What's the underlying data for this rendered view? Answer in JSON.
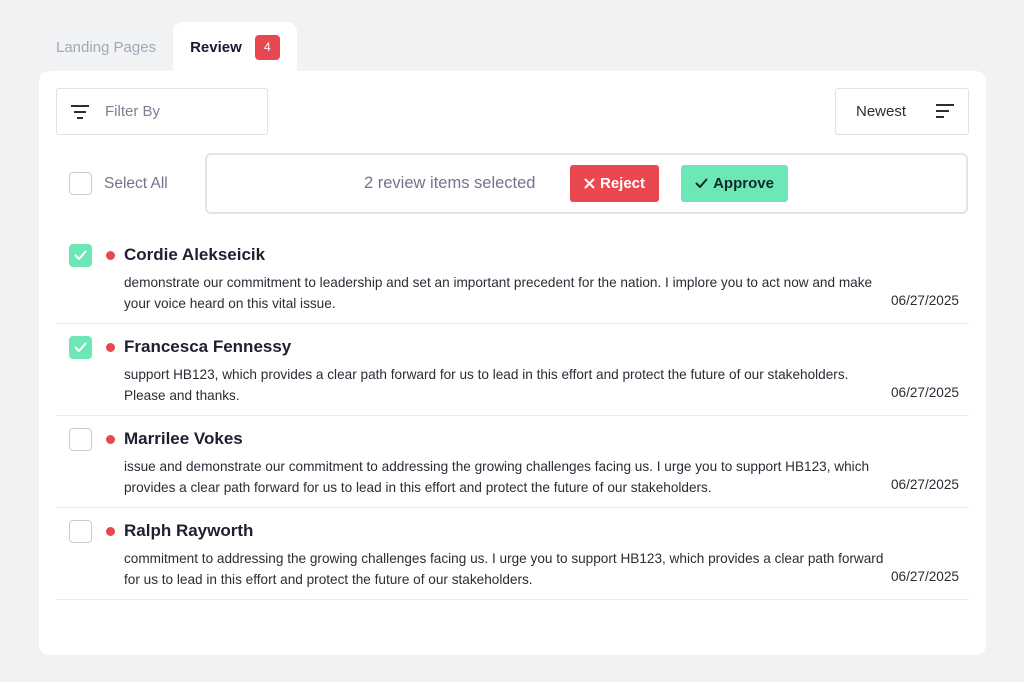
{
  "tabs": [
    {
      "label": "Landing Pages",
      "active": false
    },
    {
      "label": "Review",
      "active": true,
      "badge": "4"
    }
  ],
  "toolbar": {
    "filter_placeholder": "Filter By",
    "sort_label": "Newest"
  },
  "bulk": {
    "select_all_label": "Select All",
    "selected_text": "2 review items selected",
    "reject_label": "Reject",
    "approve_label": "Approve"
  },
  "items": [
    {
      "name": "Cordie Alekseicik",
      "body": "demonstrate our commitment to leadership and set an important precedent for the nation. I implore you to act now and make your voice heard on this vital issue.",
      "date": "06/27/2025",
      "checked": true
    },
    {
      "name": "Francesca Fennessy",
      "body": "support HB123, which provides a clear path forward for us to lead in this effort and protect the future of our stakeholders. Please and thanks.",
      "date": "06/27/2025",
      "checked": true
    },
    {
      "name": "Marrilee Vokes",
      "body": "issue and demonstrate our commitment to addressing the growing challenges facing us. I urge you to support HB123, which provides a clear path forward for us to lead in this effort and protect the future of our stakeholders.",
      "date": "06/27/2025",
      "checked": false
    },
    {
      "name": "Ralph Rayworth",
      "body": "commitment to addressing the growing challenges facing us. I urge you to support HB123, which provides a clear path forward for us to lead in this effort and protect the future of our stakeholders.",
      "date": "06/27/2025",
      "checked": false
    }
  ],
  "colors": {
    "accent_red": "#e8474f",
    "accent_green": "#6ee7b7",
    "background": "#f1f2f4"
  }
}
